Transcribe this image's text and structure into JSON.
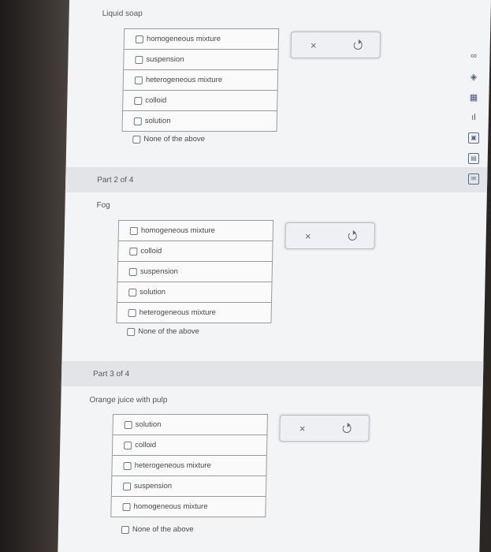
{
  "part1": {
    "question": "Liquid soap",
    "options": [
      "homogeneous mixture",
      "suspension",
      "heterogeneous mixture",
      "colloid",
      "solution"
    ],
    "none_label": "None of the above"
  },
  "part2": {
    "header": "Part 2 of 4",
    "question": "Fog",
    "options": [
      "homogeneous mixture",
      "colloid",
      "suspension",
      "solution",
      "heterogeneous mixture"
    ],
    "none_label": "None of the above"
  },
  "part3": {
    "header": "Part 3 of 4",
    "question": "Orange juice with pulp",
    "options": [
      "solution",
      "colloid",
      "heterogeneous mixture",
      "suspension",
      "homogeneous mixture"
    ],
    "none_label": "None of the above"
  },
  "actions": {
    "clear_symbol": "×",
    "undo_icon": "undo-icon"
  },
  "toolbar": {
    "icons": [
      "infinity-icon",
      "diamond-icon",
      "calculator-icon",
      "chart-icon",
      "image-icon",
      "periodic-table-icon",
      "mail-icon"
    ],
    "glyphs": [
      "∞",
      "◈",
      "▦",
      "ıl",
      "▣",
      "▤",
      "✉"
    ]
  },
  "colors": {
    "page": "#f3f4f6",
    "header": "#e2e4e7",
    "accent": "#5a6a80"
  }
}
